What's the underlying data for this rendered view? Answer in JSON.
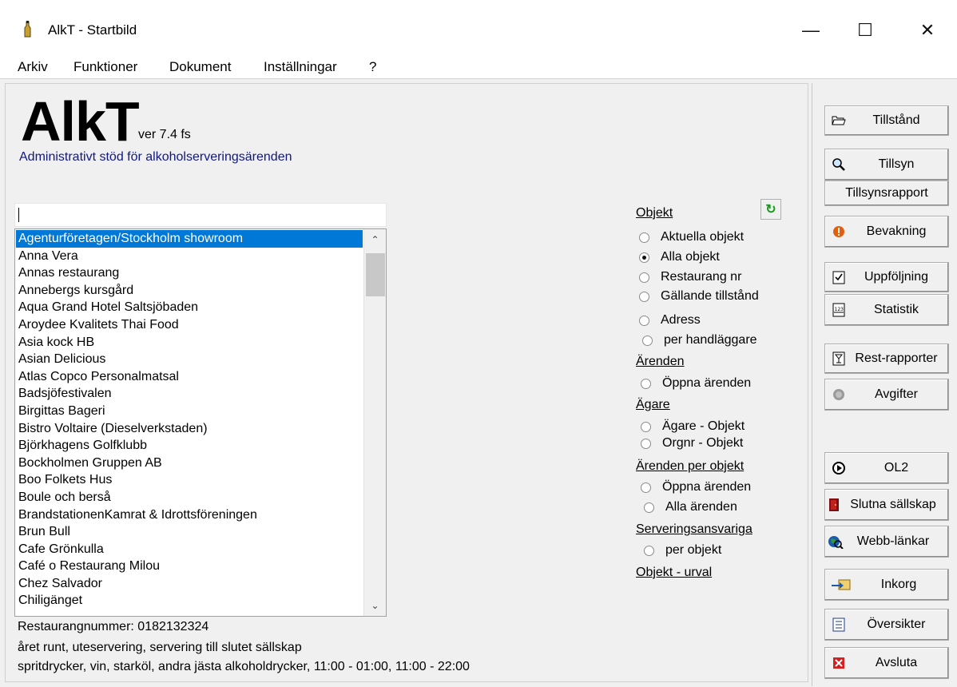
{
  "window": {
    "title": "AlkT - Startbild",
    "minimize": "—",
    "maximize": "☐",
    "close": "✕"
  },
  "menu": [
    "Arkiv",
    "Funktioner",
    "Dokument",
    "Inställningar",
    "?"
  ],
  "header": {
    "logo": "AlkT",
    "version": "ver 7.4 fs",
    "subtitle": "Administrativt stöd för alkoholserveringsärenden"
  },
  "search": {
    "value": ""
  },
  "list": {
    "selected_index": 0,
    "items": [
      "Agenturföretagen/Stockholm showroom",
      "Anna Vera",
      "Annas restaurang",
      "Annebergs kursgård",
      "Aqua Grand Hotel Saltsjöbaden",
      "Aroydee Kvalitets Thai Food",
      "Asia kock HB",
      "Asian Delicious",
      "Atlas Copco Personalmatsal",
      "Badsjöfestivalen",
      "Birgittas Bageri",
      "Bistro Voltaire (Dieselverkstaden)",
      "Björkhagens Golfklubb",
      "Bockholmen Gruppen AB",
      "Boo Folkets Hus",
      "Boule och berså",
      "BrandstationenKamrat & Idrottsföreningen",
      "Brun Bull",
      "Cafe Grönkulla",
      "Café o Restaurang Milou",
      "Chez Salvador",
      "Chiligänget"
    ]
  },
  "info": {
    "line1": "Restaurangnummer: 0182132324",
    "line2": "året runt, uteservering, servering till slutet sällskap",
    "line3": "spritdrycker, vin, starköl, andra jästa alkoholdrycker, 11:00 - 01:00, 11:00 - 22:00"
  },
  "options": {
    "objekt_head": "Objekt",
    "objekt": [
      "Aktuella objekt",
      "Alla objekt",
      "Restaurang nr",
      "Gällande tillstånd",
      "Adress",
      "per handläggare"
    ],
    "objekt_checked": 1,
    "arenden_head": "Ärenden",
    "arenden": [
      "Öppna ärenden"
    ],
    "agare_head": "Ägare",
    "agare": [
      "Ägare - Objekt",
      "Orgnr - Objekt"
    ],
    "arenden_per_objekt_head": "Ärenden per objekt",
    "arenden_per_objekt": [
      "Öppna ärenden",
      "Alla ärenden"
    ],
    "serveringsansvariga_head": "Serveringsansvariga",
    "serveringsansvariga": [
      "per objekt"
    ],
    "urval_link": "Objekt - urval"
  },
  "buttons": {
    "tillstand": "Tillstånd",
    "tillsyn": "Tillsyn",
    "tillsynsrapport": "Tillsynsrapport",
    "bevakning": "Bevakning",
    "uppfoljning": "Uppföljning",
    "statistik": "Statistik",
    "rest_rapporter": "Rest-rapporter",
    "avgifter": "Avgifter",
    "ol2": "OL2",
    "slutna": "Slutna sällskap",
    "webb": "Webb-länkar",
    "inkorg": "Inkorg",
    "oversikter": "Översikter",
    "avsluta": "Avsluta"
  },
  "colors": {
    "selection": "#0078d7",
    "subtitle": "#101880",
    "panel": "#f0f0f0"
  }
}
